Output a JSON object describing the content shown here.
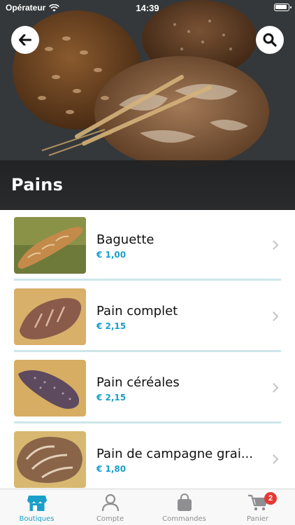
{
  "status_bar": {
    "carrier": "Opérateur",
    "time": "14:39"
  },
  "header": {
    "title": "Pains",
    "back_icon": "arrow-left-icon",
    "search_icon": "search-icon"
  },
  "products": [
    {
      "name": "Baguette",
      "price": "€ 1,00"
    },
    {
      "name": "Pain complet",
      "price": "€ 2,15"
    },
    {
      "name": "Pain céréales",
      "price": "€ 2,15"
    },
    {
      "name": "Pain de campagne grai...",
      "price": "€ 1,80"
    }
  ],
  "tabs": [
    {
      "label": "Boutiques",
      "icon": "store-icon",
      "active": true
    },
    {
      "label": "Compte",
      "icon": "user-icon",
      "active": false
    },
    {
      "label": "Commandes",
      "icon": "bag-icon",
      "active": false
    },
    {
      "label": "Panier",
      "icon": "cart-icon",
      "active": false,
      "badge": "2"
    }
  ],
  "colors": {
    "accent": "#1b9fc9",
    "badge": "#e53935",
    "separator": "#cde6ea"
  }
}
